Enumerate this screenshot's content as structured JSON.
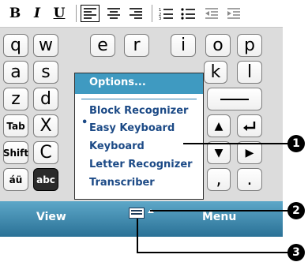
{
  "toolbar": {
    "bold": "B",
    "italic": "I",
    "underline": "U"
  },
  "keyboard": {
    "row1": [
      "q",
      "w",
      "e",
      "r",
      "i",
      "o",
      "p"
    ],
    "row2": [
      "a",
      "s",
      "k",
      "l"
    ],
    "row3": [
      "z",
      "d"
    ],
    "row4": [
      "Tab",
      "X"
    ],
    "row5": [
      "Shift",
      "C"
    ],
    "row6": [
      "áü",
      "abc",
      ",",
      "."
    ]
  },
  "menu": {
    "title": "Options...",
    "items": [
      "Block Recognizer",
      "Easy Keyboard",
      "Keyboard",
      "Letter Recognizer",
      "Transcriber"
    ],
    "selected_bullet": "•"
  },
  "bottombar": {
    "left_label": "View",
    "right_label": "Menu"
  },
  "callouts": [
    "1",
    "2",
    "3"
  ],
  "colors": {
    "menu_header": "#3f9ac1",
    "menu_text": "#1c4a86",
    "bottombar": "#2a7196"
  }
}
